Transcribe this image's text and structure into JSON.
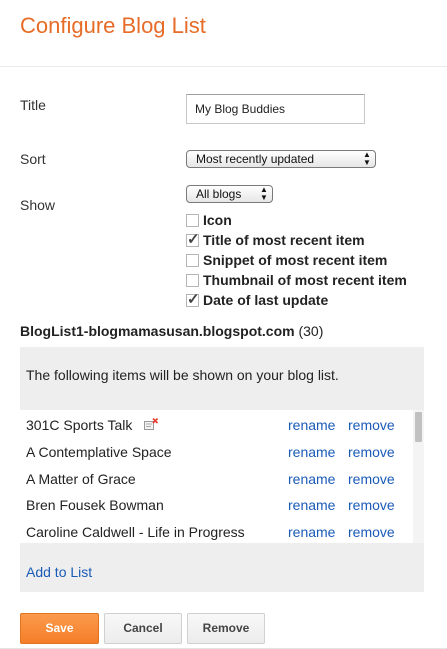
{
  "header": {
    "title": "Configure Blog List"
  },
  "form": {
    "title_label": "Title",
    "title_value": "My Blog Buddies",
    "sort_label": "Sort",
    "sort_value": "Most recently updated",
    "show_label": "Show",
    "show_value": "All blogs",
    "options": [
      {
        "label": "Icon",
        "checked": false
      },
      {
        "label": "Title of most recent item",
        "checked": true
      },
      {
        "label": "Snippet of most recent item",
        "checked": false
      },
      {
        "label": "Thumbnail of most recent item",
        "checked": false
      },
      {
        "label": "Date of last update",
        "checked": true
      }
    ]
  },
  "bloglist": {
    "name": "BlogList1-blogmamasusan.blogspot.com",
    "count": "(30)",
    "info": "The following items will be shown on your blog list.",
    "rename_label": "rename",
    "remove_label": "remove",
    "items": [
      {
        "name": "301C Sports Talk"
      },
      {
        "name": "A Contemplative Space"
      },
      {
        "name": "A Matter of Grace"
      },
      {
        "name": "Bren Fousek Bowman"
      },
      {
        "name": "Caroline Caldwell - Life in Progress"
      }
    ],
    "add_label": "Add to List"
  },
  "buttons": {
    "save": "Save",
    "cancel": "Cancel",
    "remove": "Remove"
  },
  "colors": {
    "title": "#e66c27",
    "link": "#1a5bb8",
    "save_bg": "#f57e28"
  }
}
